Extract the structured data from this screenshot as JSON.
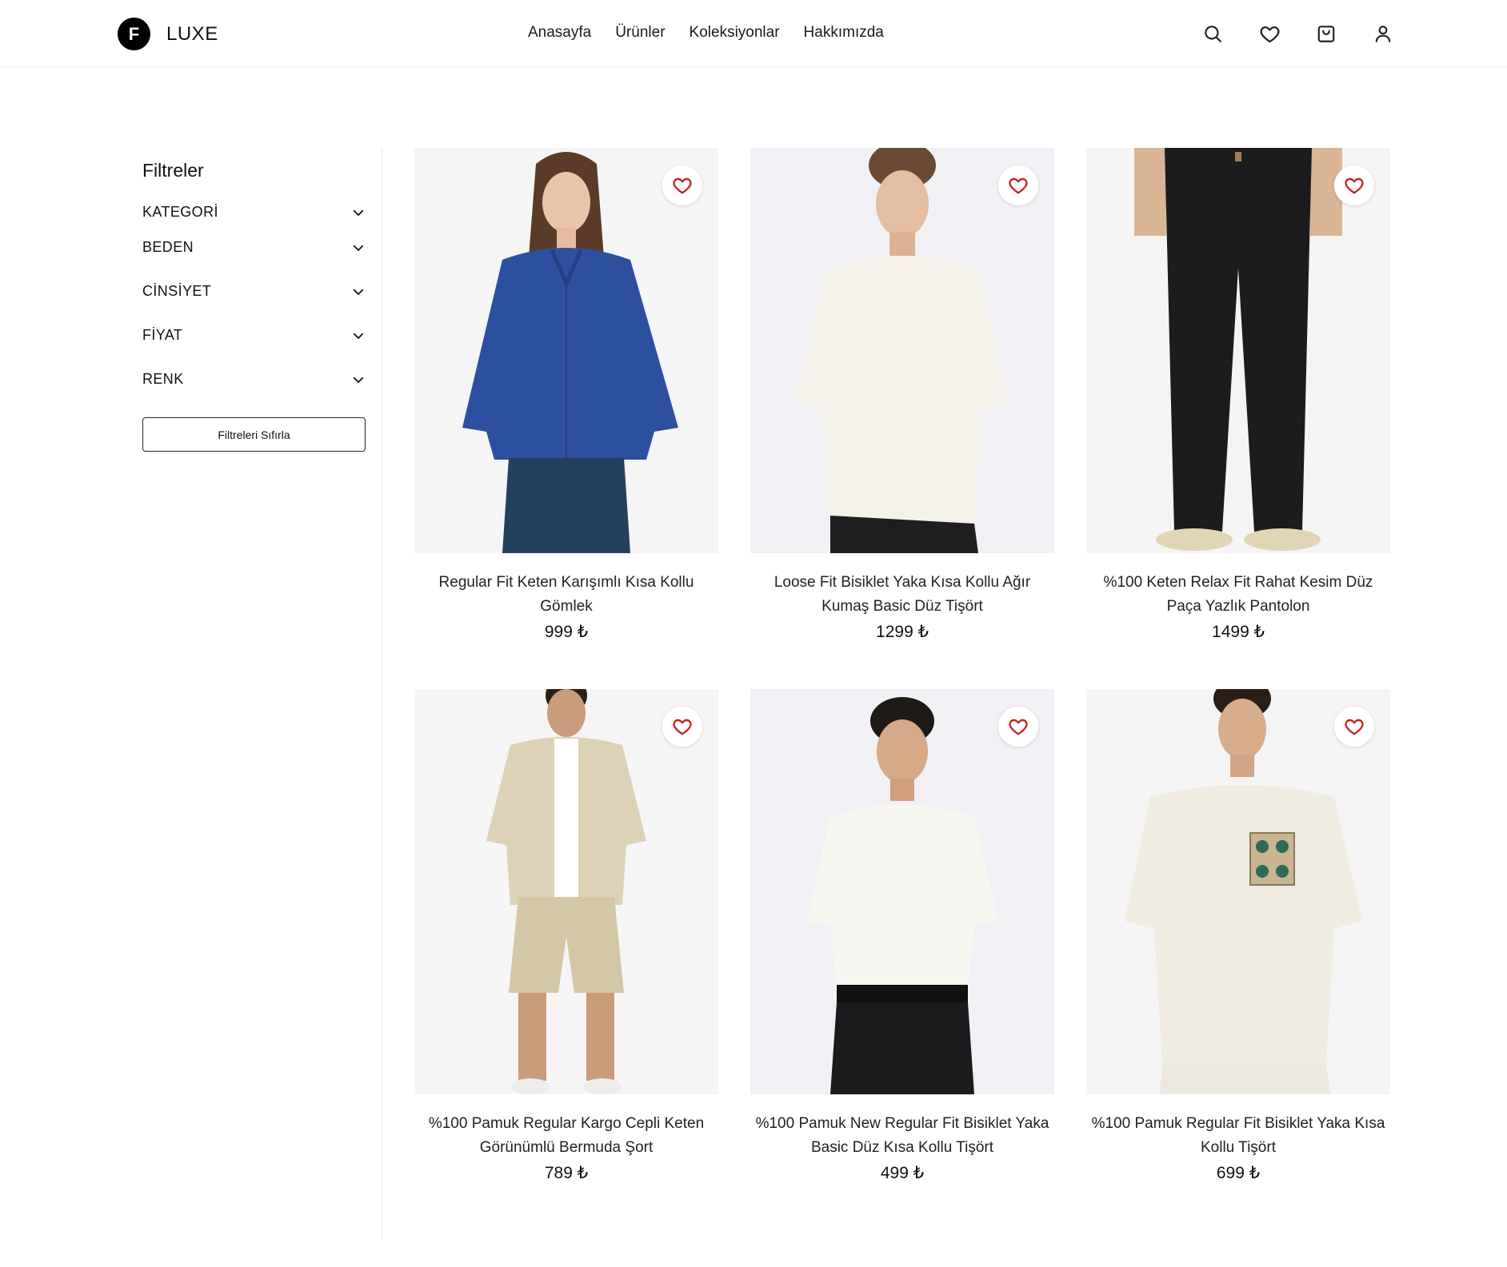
{
  "header": {
    "logo_letter": "F",
    "brand": "LUXE",
    "nav": [
      "Anasayfa",
      "Ürünler",
      "Koleksiyonlar",
      "Hakkımızda"
    ],
    "icons": [
      "search-icon",
      "heart-icon",
      "shopping-bag-icon",
      "user-icon"
    ]
  },
  "sidebar": {
    "title": "Filtreler",
    "filters": [
      "KATEGORİ",
      "BEDEN",
      "CİNSİYET",
      "FİYAT",
      "RENK"
    ],
    "reset_label": "Filtreleri Sıfırla"
  },
  "products": [
    {
      "title": "Regular Fit Keten Karışımlı Kısa Kollu Gömlek",
      "price": "999 ₺"
    },
    {
      "title": "Loose Fit Bisiklet Yaka Kısa Kollu Ağır Kumaş Basic Düz Tişört",
      "price": "1299 ₺"
    },
    {
      "title": "%100 Keten Relax Fit Rahat Kesim Düz Paça Yazlık Pantolon",
      "price": "1499 ₺"
    },
    {
      "title": "%100 Pamuk Regular Kargo Cepli Keten Görünümlü Bermuda Şort",
      "price": "789 ₺"
    },
    {
      "title": "%100 Pamuk New Regular Fit Bisiklet Yaka Basic Düz Kısa Kollu Tişört",
      "price": "499 ₺"
    },
    {
      "title": "%100 Pamuk Regular Fit Bisiklet Yaka Kısa Kollu Tişört",
      "price": "699 ₺"
    }
  ],
  "colors": {
    "heart": "#c62828",
    "accent": "#000000"
  }
}
